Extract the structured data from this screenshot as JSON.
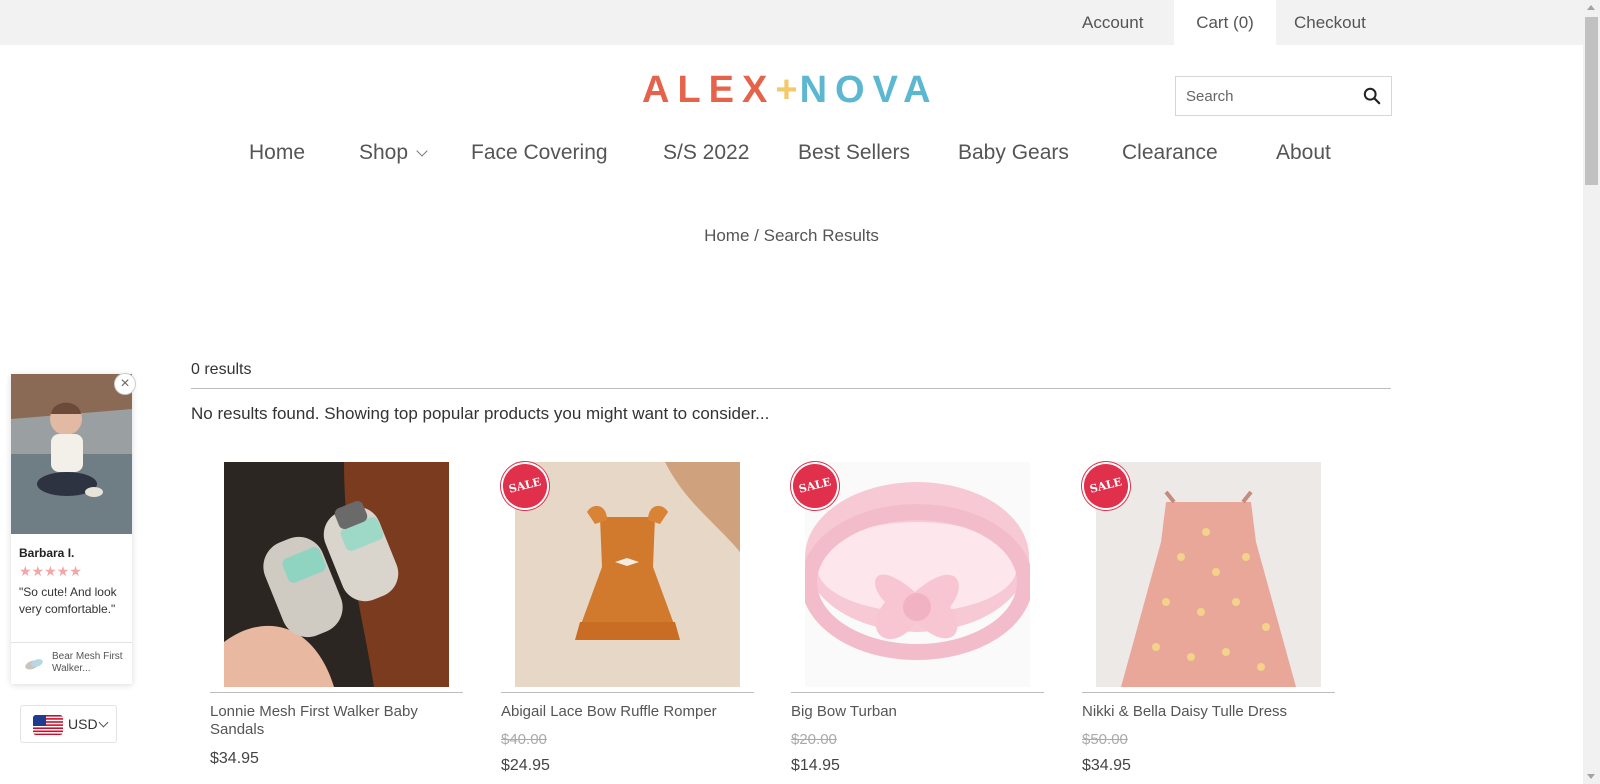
{
  "topbar": {
    "account": "Account",
    "cart": "Cart (0)",
    "checkout": "Checkout"
  },
  "logo": {
    "left": "ALEX",
    "plus": "+",
    "right": "NOVA",
    "colors": {
      "alex": "#e5634a",
      "plus": "#f2c96b",
      "nova": "#5bb8d0"
    }
  },
  "search": {
    "placeholder": "Search",
    "icon": "search-icon"
  },
  "nav": {
    "items": [
      "Home",
      "Shop",
      "Face Covering",
      "S/S 2022",
      "Best Sellers",
      "Baby Gears",
      "Clearance",
      "About"
    ]
  },
  "breadcrumb": {
    "home": "Home",
    "separator": "/",
    "current": "Search Results"
  },
  "results": {
    "count": "0 results",
    "message": "No results found. Showing top popular products you might want to consider..."
  },
  "products": [
    {
      "name": "Lonnie Mesh First Walker Baby Sandals",
      "old_price": "",
      "price": "$34.95",
      "sale": false
    },
    {
      "name": "Abigail Lace Bow Ruffle Romper",
      "old_price": "$40.00",
      "price": "$24.95",
      "sale": true
    },
    {
      "name": "Big Bow Turban",
      "old_price": "$20.00",
      "price": "$14.95",
      "sale": true
    },
    {
      "name": "Nikki & Bella Daisy Tulle Dress",
      "old_price": "$50.00",
      "price": "$34.95",
      "sale": true
    }
  ],
  "sale_badge": "SALE",
  "review_popup": {
    "reviewer": "Barbara I.",
    "stars": "★★★★★",
    "rating": 5,
    "quote": "\"So cute! And look very comfortable.\"",
    "product": "Bear Mesh First Walker...",
    "close": "×"
  },
  "currency": {
    "code": "USD"
  },
  "colors": {
    "topbar_bg": "#f2f2f2",
    "sale_badge": "#e0304c",
    "text": "#555555"
  }
}
